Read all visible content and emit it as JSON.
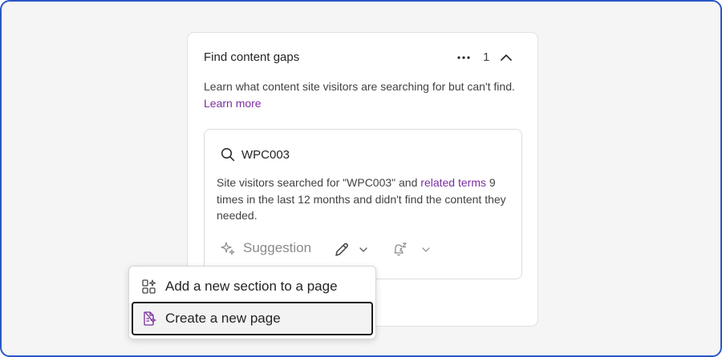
{
  "panel": {
    "title": "Find content gaps",
    "count": "1",
    "description": "Learn what content site visitors are searching for but can't find.",
    "learn_more": "Learn more"
  },
  "card": {
    "query": "WPC003",
    "text_before": "Site visitors searched for \"WPC003\" and",
    "related_terms": "related terms",
    "text_after": "9 times in the last 12 months and didn't find the content they needed.",
    "suggestion_label": "Suggestion"
  },
  "menu": {
    "items": [
      {
        "label": "Add a new section to a page"
      },
      {
        "label": "Create a new page"
      }
    ]
  },
  "icons": {
    "more": "more-horizontal-icon",
    "collapse": "chevron-up-icon",
    "search": "search-icon",
    "sparkle": "sparkle-icon",
    "edit": "pencil-icon",
    "snooze": "snooze-bell-icon",
    "dropdown": "chevron-down-icon",
    "add_section": "add-section-icon",
    "new_page": "new-page-icon"
  },
  "colors": {
    "accent_link": "#7b2e9f",
    "frame_border": "#2b56c8",
    "background": "#f5f5f5"
  }
}
